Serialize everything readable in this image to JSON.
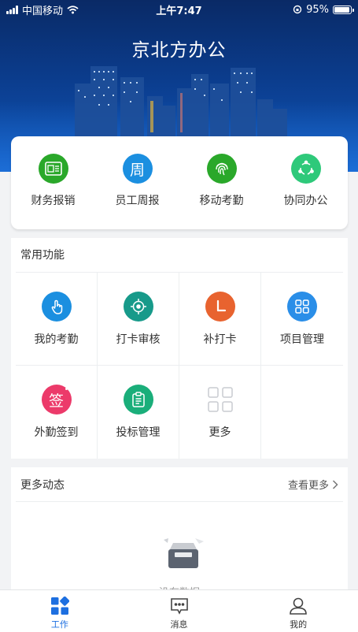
{
  "status_bar": {
    "carrier": "中国移动",
    "time": "上午7:47",
    "battery": "95%",
    "battery_level": 0.95
  },
  "header": {
    "title": "京北方办公"
  },
  "quick_actions": [
    {
      "label": "财务报销",
      "icon": "invoice-icon",
      "color": "#2aa82a"
    },
    {
      "label": "员工周报",
      "icon": "weekly-report-icon",
      "color": "#1b8fe0"
    },
    {
      "label": "移动考勤",
      "icon": "fingerprint-icon",
      "color": "#2aa82a"
    },
    {
      "label": "协同办公",
      "icon": "collaboration-icon",
      "color": "#2ec97a"
    }
  ],
  "common_functions": {
    "title": "常用功能",
    "items": [
      {
        "label": "我的考勤",
        "icon": "tap-hand-icon",
        "color": "#1b8fe0"
      },
      {
        "label": "打卡审核",
        "icon": "target-icon",
        "color": "#179a8a"
      },
      {
        "label": "补打卡",
        "icon": "clock-icon",
        "color": "#e8632f"
      },
      {
        "label": "项目管理",
        "icon": "grid-icon",
        "color": "#2a8ee8"
      },
      {
        "label": "外勤签到",
        "icon": "sign-icon",
        "color": "#ec3a6a",
        "glyph": "签"
      },
      {
        "label": "投标管理",
        "icon": "clipboard-icon",
        "color": "#1aae7a"
      },
      {
        "label": "更多",
        "icon": "more-grid-icon",
        "color": "#cfd2d6"
      }
    ]
  },
  "more_updates": {
    "title": "更多动态",
    "view_more": "查看更多",
    "empty_text": "没有数据"
  },
  "tab_bar": [
    {
      "label": "工作",
      "icon": "work-icon",
      "active": true
    },
    {
      "label": "消息",
      "icon": "message-icon",
      "active": false
    },
    {
      "label": "我的",
      "icon": "profile-icon",
      "active": false
    }
  ],
  "colors": {
    "accent": "#1d6fe0",
    "hero_top": "#0a2a66",
    "hero_bottom": "#0e55b8"
  }
}
